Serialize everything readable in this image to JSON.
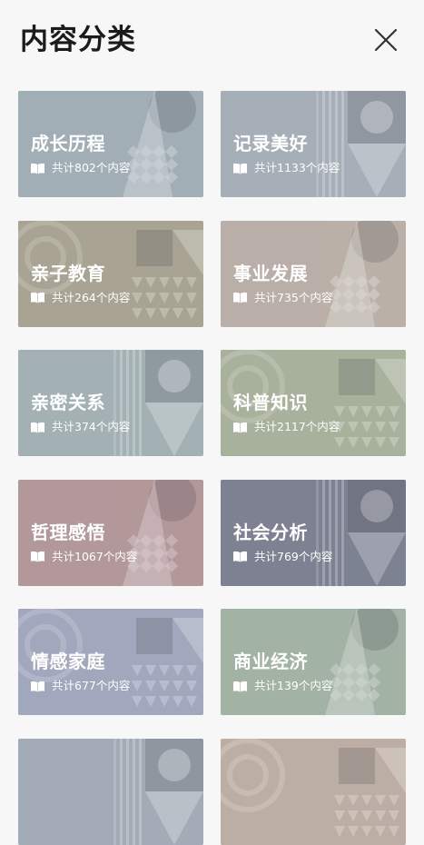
{
  "header": {
    "title": "内容分类",
    "close_icon": "close-icon"
  },
  "categories": [
    {
      "label": "成长历程",
      "count": "共计802个内容",
      "color": "#a1aeb6"
    },
    {
      "label": "记录美好",
      "count": "共计1133个内容",
      "color": "#a6aeb8"
    },
    {
      "label": "亲子教育",
      "count": "共计264个内容",
      "color": "#a8a393"
    },
    {
      "label": "事业发展",
      "count": "共计735个内容",
      "color": "#bab0a8"
    },
    {
      "label": "亲密关系",
      "count": "共计374个内容",
      "color": "#a3b1b5"
    },
    {
      "label": "科普知识",
      "count": "共计2117个内容",
      "color": "#a8b19c"
    },
    {
      "label": "哲理感悟",
      "count": "共计1067个内容",
      "color": "#b3989a"
    },
    {
      "label": "社会分析",
      "count": "共计769个内容",
      "color": "#7d8292"
    },
    {
      "label": "情感家庭",
      "count": "共计677个内容",
      "color": "#a1a8bd"
    },
    {
      "label": "商业经济",
      "count": "共计139个内容",
      "color": "#a2b2a4"
    },
    {
      "label": "",
      "count": "",
      "color": "#a3acb6"
    },
    {
      "label": "",
      "count": "",
      "color": "#bcaea4"
    }
  ],
  "icons": {
    "book": "book-icon",
    "close": "close-icon"
  }
}
